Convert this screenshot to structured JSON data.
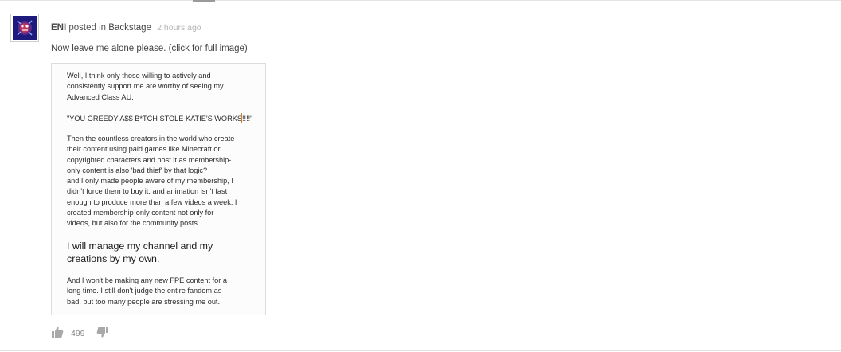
{
  "post": {
    "author": "ENI",
    "posted_in": "posted in",
    "channel": "Backstage",
    "time": "2 hours ago",
    "text": "Now leave me alone please. (click for full image)"
  },
  "image": {
    "p1": [
      "Well, I think only those willing to actively and",
      "consistently support me are worthy of seeing my",
      "Advanced Class AU."
    ],
    "p2": "\"YOU GREEDY A$$ B*TCH STOLE KATIE'S WORKS",
    "p2_end": "!!!!\"",
    "p3": [
      "Then the countless creators in the world who create",
      "their content using paid games like Minecraft or",
      "copyrighted characters and post it as membership-",
      "only content is also 'bad thief' by that logic?",
      "and I only made people aware of my membership, I",
      "didn't force them to buy it. and animation isn't fast",
      "enough to produce more than a few videos a week. I",
      "created membership-only content not only for",
      "videos, but also for the community posts."
    ],
    "p4": [
      "I will manage my channel and my",
      "creations by my own."
    ],
    "p5": [
      "And I won't be making any new FPE content for a",
      "long time. I still don't judge the entire fandom as",
      "bad, but too many people are stressing me out."
    ]
  },
  "actions": {
    "like_count": "499",
    "like_icon": "thumbs-up-icon",
    "dislike_icon": "thumbs-down-icon"
  },
  "colors": {
    "avatar_bg": "#1c1a7a",
    "avatar_accent": "#c0335a",
    "muted_text": "#b5b5b5",
    "border": "#dcdcdc"
  }
}
